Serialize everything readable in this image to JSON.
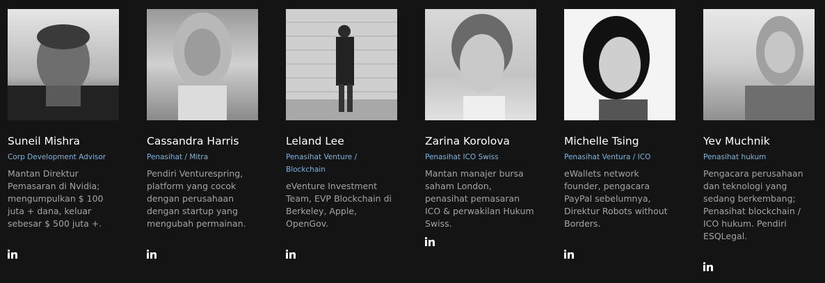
{
  "members": [
    {
      "name": "Suneil Mishra",
      "role": "Corp Development Advisor",
      "bio": "Mantan Direktur Pemasaran di Nvidia; mengumpulkan $ 100 juta + dana, keluar sebesar $ 500 juta +.",
      "social_icon": "linkedin-icon"
    },
    {
      "name": "Cassandra Harris",
      "role": "Penasihat / Mitra",
      "bio": "Pendiri Venturespring, platform yang cocok dengan perusahaan dengan startup yang mengubah permainan.",
      "social_icon": "linkedin-icon"
    },
    {
      "name": "Leland Lee",
      "role": "Penasihat Venture / Blockchain",
      "bio": "eVenture Investment Team, EVP Blockchain di Berkeley, Apple, OpenGov.",
      "social_icon": "linkedin-icon"
    },
    {
      "name": "Zarina Korolova",
      "role": "Penasihat ICO Swiss",
      "bio": "Mantan manajer bursa saham London, penasihat pemasaran ICO & perwakilan Hukum Swiss.",
      "social_icon": "linkedin-icon"
    },
    {
      "name": "Michelle Tsing",
      "role": "Penasihat Ventura / ICO",
      "bio": "eWallets network founder, pengacara PayPal sebelumnya, Direktur Robots without Borders.",
      "social_icon": "linkedin-icon"
    },
    {
      "name": "Yev Muchnik",
      "role": "Penasihat hukum",
      "bio": "Pengacara perusahaan dan teknologi yang sedang berkembang; Penasihat blockchain / ICO hukum. Pendiri ESQLegal.",
      "social_icon": "linkedin-icon"
    }
  ],
  "colors": {
    "background": "#141414",
    "name": "#ffffff",
    "role": "#7fb3d8",
    "bio": "#a4a4a4"
  }
}
